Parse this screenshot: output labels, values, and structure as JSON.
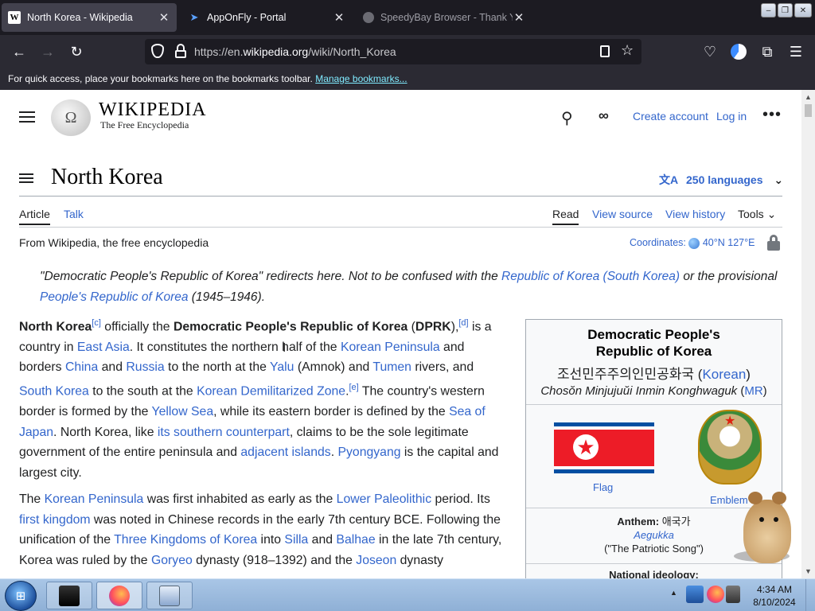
{
  "browser": {
    "tabs": [
      {
        "title": "North Korea - Wikipedia",
        "icon": "W",
        "close": "✕"
      },
      {
        "title": "AppOnFly - Portal",
        "icon": "➤",
        "close": "✕"
      },
      {
        "title": "SpeedyBay Browser - Thank Yo",
        "icon": "",
        "close": "✕"
      }
    ],
    "window_buttons": {
      "minimize": "–",
      "maximize": "❐",
      "close": "✕"
    },
    "url": {
      "prefix": "https://en.",
      "domain": "wikipedia.org",
      "path": "/wiki/North_Korea"
    },
    "bookmarks_message": "For quick access, place your bookmarks here on the bookmarks toolbar.",
    "manage_bookmarks": "Manage bookmarks..."
  },
  "wiki": {
    "logo_glyph": "Ω",
    "wordmark": "WIKIPEDIA",
    "tagline": "The Free Encyclopedia",
    "create_account": "Create account",
    "log_in": "Log in",
    "title": "North Korea",
    "languages": "250 languages",
    "tabs": {
      "article": "Article",
      "talk": "Talk",
      "read": "Read",
      "view_source": "View source",
      "view_history": "View history",
      "tools": "Tools"
    },
    "from": "From Wikipedia, the free encyclopedia",
    "coordinates_label": "Coordinates:",
    "coordinates_value": "40°N 127°E",
    "hatnote": {
      "t1": "\"Democratic People's Republic of Korea\" redirects here. Not to be confused with the ",
      "l1": "Republic of Korea (South Korea)",
      "t2": " or the provisional ",
      "l2": "People's Republic of Korea",
      "t3": " (1945–1946)."
    },
    "lead": {
      "b1": "North Korea",
      "s1": "[c]",
      "t1": " officially the ",
      "b2": "Democratic People's Republic of Korea",
      "t2": " (",
      "b3": "DPRK",
      "t3": "),",
      "s2": "[d]",
      "t4": " is a country in ",
      "l1": "East Asia",
      "t5": ". It constitutes the northern half of the ",
      "l2": "Korean Peninsula",
      "t6": " and borders ",
      "l3": "China",
      "t7": " and ",
      "l4": "Russia",
      "t8": " to the north at the ",
      "l5": "Yalu",
      "t9": " (Amnok) and ",
      "l6": "Tumen",
      "t10": " rivers, and ",
      "l7": "South Korea",
      "t11": " to the south at the ",
      "l8": "Korean Demilitarized Zone",
      "t12": ".",
      "s3": "[e]",
      "t13": " The country's western border is formed by the ",
      "l9": "Yellow Sea",
      "t14": ", while its eastern border is defined by the ",
      "l10": "Sea of Japan",
      "t15": ". North Korea, like ",
      "l11": "its southern counterpart",
      "t16": ", claims to be the sole legitimate government of the entire peninsula and ",
      "l12": "adjacent islands",
      "t17": ". ",
      "l13": "Pyongyang",
      "t18": " is the capital and largest city."
    },
    "p2": {
      "t1": "The ",
      "l1": "Korean Peninsula",
      "t2": " was first inhabited as early as the ",
      "l2": "Lower Paleolithic",
      "t3": " period. Its ",
      "l3": "first kingdom",
      "t4": " was noted in Chinese records in the early 7th century BCE. Following the unification of the ",
      "l4": "Three Kingdoms of Korea",
      "t5": " into ",
      "l5": "Silla",
      "t6": " and ",
      "l6": "Balhae",
      "t7": " in the late 7th century, Korea was ruled by the ",
      "l7": "Goryeo",
      "t8": " dynasty (918–1392) and the ",
      "l8": "Joseon",
      "t9": " dynasty"
    },
    "infobox": {
      "title_line1": "Democratic People's",
      "title_line2": "Republic of Korea",
      "native": "조선민주주의인민공화국",
      "native_lang": "Korean",
      "romanized": "Chosŏn Minjujuŭi Inmin Konghwaguk",
      "romanized_sys": "MR",
      "flag_caption": "Flag",
      "emblem_caption": "Emblem",
      "anthem_label": "Anthem:",
      "anthem_korean": "애국가",
      "anthem_roman": "Aegukka",
      "anthem_english": "(\"The Patriotic Song\")",
      "ideology_label": "National ideology:"
    }
  },
  "taskbar": {
    "start_glyph": "⊞",
    "time": "4:34 AM",
    "date": "8/10/2024",
    "tray_arrow": "▲"
  },
  "colors": {
    "link": "#3366cc",
    "chrome_dark": "#1c1b22",
    "toolbar": "#2b2a33",
    "accent_cyan": "#80ebff"
  }
}
